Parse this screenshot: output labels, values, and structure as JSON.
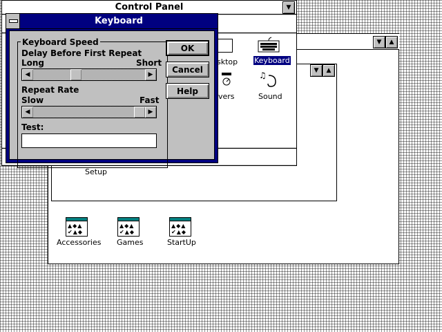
{
  "program_manager": {
    "groups": [
      {
        "label": "Accessories",
        "icon": "program-group-icon"
      },
      {
        "label": "Games",
        "icon": "program-group-icon"
      },
      {
        "label": "StartUp",
        "icon": "program-group-icon"
      }
    ],
    "main_group": {
      "setup_label": "Setup"
    }
  },
  "control_panel": {
    "title": "Control Panel",
    "icons": [
      {
        "label": "Desktop",
        "visible_label": "sktop",
        "icon": "desktop-icon"
      },
      {
        "label": "Keyboard",
        "icon": "keyboard-icon",
        "selected": true
      },
      {
        "label": "Drivers",
        "visible_label": "vers",
        "icon": "drivers-icon"
      },
      {
        "label": "Sound",
        "icon": "sound-icon"
      }
    ]
  },
  "keyboard_dialog": {
    "title": "Keyboard",
    "group_title": "Keyboard Speed",
    "delay": {
      "label": "Delay Before First Repeat",
      "min_label": "Long",
      "max_label": "Short",
      "value_fraction": 0.37
    },
    "rate": {
      "label": "Repeat Rate",
      "min_label": "Slow",
      "max_label": "Fast",
      "value_fraction": 1.0
    },
    "test": {
      "label": "Test:",
      "value": "",
      "placeholder": ""
    },
    "buttons": {
      "ok": "OK",
      "cancel": "Cancel",
      "help": "Help"
    }
  },
  "colors": {
    "active_title": "#000080",
    "face": "#c0c0c0",
    "selection": "#000080"
  }
}
